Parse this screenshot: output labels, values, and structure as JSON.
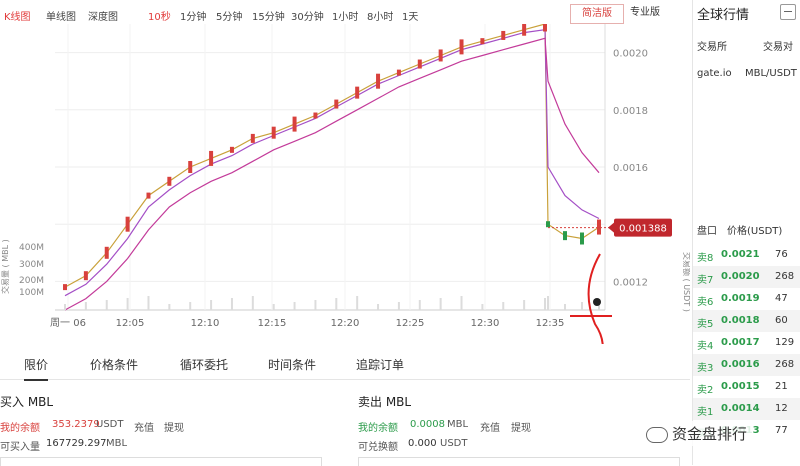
{
  "toolbar": {
    "tabs": [
      "K线图",
      "单线图",
      "深度图"
    ],
    "periods": [
      "10秒",
      "1分钟",
      "5分钟",
      "15分钟",
      "30分钟",
      "1小时",
      "8小时",
      "1天"
    ],
    "mode_simple": "简洁版",
    "mode_pro": "专业版"
  },
  "chart_data": {
    "type": "line",
    "series": [
      {
        "values": [
          0.00118,
          0.00122,
          0.0013,
          0.0014,
          0.0015,
          0.00155,
          0.0016,
          0.00163,
          0.00166,
          0.0017,
          0.00172,
          0.00175,
          0.00178,
          0.00182,
          0.00186,
          0.0019,
          0.00193,
          0.00196,
          0.00199,
          0.00202,
          0.00204,
          0.00206,
          0.00208,
          0.0021,
          0.0014,
          0.00136,
          0.00135,
          0.00139
        ]
      },
      {
        "values": [
          0.00115,
          0.00119,
          0.00126,
          0.00135,
          0.00146,
          0.00152,
          0.00157,
          0.00161,
          0.00164,
          0.00168,
          0.00171,
          0.00174,
          0.00177,
          0.00181,
          0.00185,
          0.00189,
          0.00192,
          0.00195,
          0.00198,
          0.00201,
          0.00203,
          0.00205,
          0.00207,
          0.00208,
          0.0016,
          0.0015,
          0.00145,
          0.00142
        ]
      },
      {
        "values": [
          0.0011,
          0.00114,
          0.0012,
          0.00128,
          0.00138,
          0.00146,
          0.00151,
          0.00155,
          0.00158,
          0.00162,
          0.00166,
          0.00169,
          0.00172,
          0.00176,
          0.0018,
          0.00184,
          0.00188,
          0.00191,
          0.00194,
          0.00197,
          0.00199,
          0.00201,
          0.00203,
          0.00205,
          0.0019,
          0.00175,
          0.00165,
          0.00158
        ]
      }
    ],
    "x_ticks": [
      "周一 06",
      "12:05",
      "12:10",
      "12:15",
      "12:20",
      "12:25",
      "12:30",
      "12:35"
    ],
    "y_ticks": [
      "0.0020",
      "0.0018",
      "0.0016",
      "0.0014",
      "0.0012"
    ],
    "ylim": [
      0.0011,
      0.0021
    ],
    "volume_ticks": [
      "400M",
      "300M",
      "200M",
      "100M"
    ],
    "volume_label": "交易量 ( MBL )",
    "volume_label_right": "交易额 ( USDT )",
    "last_price": "0.001388",
    "grid": true
  },
  "colors": {
    "up": "#d8413d",
    "down": "#2b9b4a",
    "ma1": "#c9a13a",
    "ma2": "#a44fc6",
    "ma3": "#c33b9a"
  },
  "right_panel": {
    "title": "全球行情",
    "col1": "交易所",
    "col2": "交易对",
    "row_exchange": "gate.io",
    "row_pair": "MBL/USDT",
    "ob_col1": "盘口",
    "ob_col2": "价格(USDT)",
    "orderbook": [
      {
        "side": "卖8",
        "price": "0.0021",
        "qty": "76"
      },
      {
        "side": "卖7",
        "price": "0.0020",
        "qty": "268"
      },
      {
        "side": "卖6",
        "price": "0.0019",
        "qty": "47"
      },
      {
        "side": "卖5",
        "price": "0.0018",
        "qty": "60"
      },
      {
        "side": "卖4",
        "price": "0.0017",
        "qty": "129"
      },
      {
        "side": "卖3",
        "price": "0.0016",
        "qty": "268"
      },
      {
        "side": "卖2",
        "price": "0.0015",
        "qty": "21"
      },
      {
        "side": "卖1",
        "price": "0.0014",
        "qty": "12"
      },
      {
        "side": "买1",
        "price": "0.0013",
        "qty": "77"
      }
    ]
  },
  "bottom": {
    "tabs": [
      "限价",
      "价格条件",
      "循环委托",
      "时间条件",
      "追踪订单"
    ],
    "buy_title": "买入 MBL",
    "buy_balance_label": "我的余额",
    "buy_balance": "353.2379",
    "buy_balance_unit": "USDT",
    "buy_deposit": "充值",
    "buy_withdraw": "提现",
    "buy_avail_label": "可买入量",
    "buy_avail": "167729.297",
    "buy_avail_unit": "MBL",
    "sell_title": "卖出 MBL",
    "sell_balance_label": "我的余额",
    "sell_balance": "0.0008",
    "sell_balance_unit": "MBL",
    "sell_deposit": "充值",
    "sell_withdraw": "提现",
    "sell_avail_label": "可兑换额",
    "sell_avail": "0.000",
    "sell_avail_unit": "USDT"
  },
  "watermark": "资金盘排行"
}
